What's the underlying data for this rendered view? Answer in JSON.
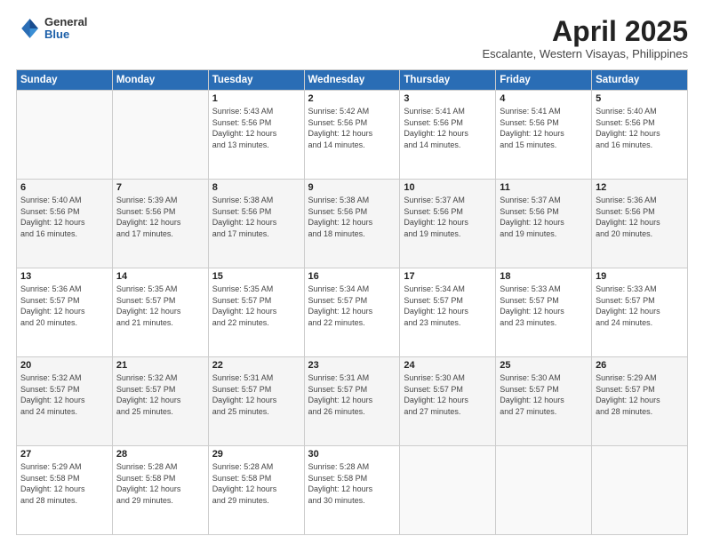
{
  "header": {
    "logo_general": "General",
    "logo_blue": "Blue",
    "month_title": "April 2025",
    "location": "Escalante, Western Visayas, Philippines"
  },
  "days_of_week": [
    "Sunday",
    "Monday",
    "Tuesday",
    "Wednesday",
    "Thursday",
    "Friday",
    "Saturday"
  ],
  "weeks": [
    [
      {
        "day": "",
        "info": ""
      },
      {
        "day": "",
        "info": ""
      },
      {
        "day": "1",
        "info": "Sunrise: 5:43 AM\nSunset: 5:56 PM\nDaylight: 12 hours\nand 13 minutes."
      },
      {
        "day": "2",
        "info": "Sunrise: 5:42 AM\nSunset: 5:56 PM\nDaylight: 12 hours\nand 14 minutes."
      },
      {
        "day": "3",
        "info": "Sunrise: 5:41 AM\nSunset: 5:56 PM\nDaylight: 12 hours\nand 14 minutes."
      },
      {
        "day": "4",
        "info": "Sunrise: 5:41 AM\nSunset: 5:56 PM\nDaylight: 12 hours\nand 15 minutes."
      },
      {
        "day": "5",
        "info": "Sunrise: 5:40 AM\nSunset: 5:56 PM\nDaylight: 12 hours\nand 16 minutes."
      }
    ],
    [
      {
        "day": "6",
        "info": "Sunrise: 5:40 AM\nSunset: 5:56 PM\nDaylight: 12 hours\nand 16 minutes."
      },
      {
        "day": "7",
        "info": "Sunrise: 5:39 AM\nSunset: 5:56 PM\nDaylight: 12 hours\nand 17 minutes."
      },
      {
        "day": "8",
        "info": "Sunrise: 5:38 AM\nSunset: 5:56 PM\nDaylight: 12 hours\nand 17 minutes."
      },
      {
        "day": "9",
        "info": "Sunrise: 5:38 AM\nSunset: 5:56 PM\nDaylight: 12 hours\nand 18 minutes."
      },
      {
        "day": "10",
        "info": "Sunrise: 5:37 AM\nSunset: 5:56 PM\nDaylight: 12 hours\nand 19 minutes."
      },
      {
        "day": "11",
        "info": "Sunrise: 5:37 AM\nSunset: 5:56 PM\nDaylight: 12 hours\nand 19 minutes."
      },
      {
        "day": "12",
        "info": "Sunrise: 5:36 AM\nSunset: 5:56 PM\nDaylight: 12 hours\nand 20 minutes."
      }
    ],
    [
      {
        "day": "13",
        "info": "Sunrise: 5:36 AM\nSunset: 5:57 PM\nDaylight: 12 hours\nand 20 minutes."
      },
      {
        "day": "14",
        "info": "Sunrise: 5:35 AM\nSunset: 5:57 PM\nDaylight: 12 hours\nand 21 minutes."
      },
      {
        "day": "15",
        "info": "Sunrise: 5:35 AM\nSunset: 5:57 PM\nDaylight: 12 hours\nand 22 minutes."
      },
      {
        "day": "16",
        "info": "Sunrise: 5:34 AM\nSunset: 5:57 PM\nDaylight: 12 hours\nand 22 minutes."
      },
      {
        "day": "17",
        "info": "Sunrise: 5:34 AM\nSunset: 5:57 PM\nDaylight: 12 hours\nand 23 minutes."
      },
      {
        "day": "18",
        "info": "Sunrise: 5:33 AM\nSunset: 5:57 PM\nDaylight: 12 hours\nand 23 minutes."
      },
      {
        "day": "19",
        "info": "Sunrise: 5:33 AM\nSunset: 5:57 PM\nDaylight: 12 hours\nand 24 minutes."
      }
    ],
    [
      {
        "day": "20",
        "info": "Sunrise: 5:32 AM\nSunset: 5:57 PM\nDaylight: 12 hours\nand 24 minutes."
      },
      {
        "day": "21",
        "info": "Sunrise: 5:32 AM\nSunset: 5:57 PM\nDaylight: 12 hours\nand 25 minutes."
      },
      {
        "day": "22",
        "info": "Sunrise: 5:31 AM\nSunset: 5:57 PM\nDaylight: 12 hours\nand 25 minutes."
      },
      {
        "day": "23",
        "info": "Sunrise: 5:31 AM\nSunset: 5:57 PM\nDaylight: 12 hours\nand 26 minutes."
      },
      {
        "day": "24",
        "info": "Sunrise: 5:30 AM\nSunset: 5:57 PM\nDaylight: 12 hours\nand 27 minutes."
      },
      {
        "day": "25",
        "info": "Sunrise: 5:30 AM\nSunset: 5:57 PM\nDaylight: 12 hours\nand 27 minutes."
      },
      {
        "day": "26",
        "info": "Sunrise: 5:29 AM\nSunset: 5:57 PM\nDaylight: 12 hours\nand 28 minutes."
      }
    ],
    [
      {
        "day": "27",
        "info": "Sunrise: 5:29 AM\nSunset: 5:58 PM\nDaylight: 12 hours\nand 28 minutes."
      },
      {
        "day": "28",
        "info": "Sunrise: 5:28 AM\nSunset: 5:58 PM\nDaylight: 12 hours\nand 29 minutes."
      },
      {
        "day": "29",
        "info": "Sunrise: 5:28 AM\nSunset: 5:58 PM\nDaylight: 12 hours\nand 29 minutes."
      },
      {
        "day": "30",
        "info": "Sunrise: 5:28 AM\nSunset: 5:58 PM\nDaylight: 12 hours\nand 30 minutes."
      },
      {
        "day": "",
        "info": ""
      },
      {
        "day": "",
        "info": ""
      },
      {
        "day": "",
        "info": ""
      }
    ]
  ]
}
